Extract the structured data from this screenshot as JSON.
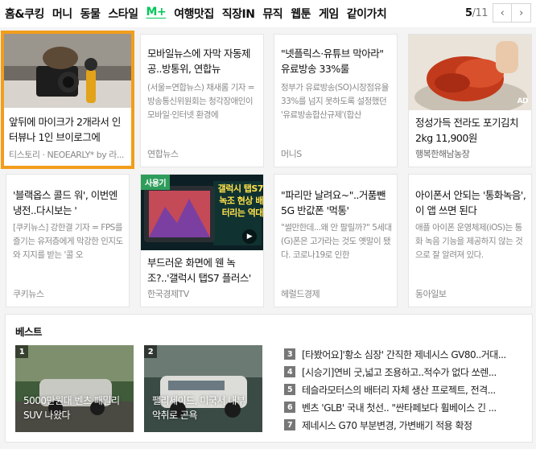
{
  "categories": [
    "홈&쿠킹",
    "머니",
    "동물",
    "스타일",
    "M+",
    "여행맛집",
    "직장IN",
    "뮤직",
    "웹툰",
    "게임",
    "같이가치"
  ],
  "active_category": "M+",
  "pager": {
    "current": "5",
    "total": "/11",
    "prev": "‹",
    "next": "›"
  },
  "cards": [
    {
      "title": "앞뒤에 마이크가 2개라서 인터뷰나 1인 브이로그에",
      "source": "티스토리 · NEOEARLY* by 라..."
    },
    {
      "title": "모바일뉴스에 자막 자동제공..방통위, 연합뉴",
      "desc": "(서울=연합뉴스) 채새롬 기자 = 방송통신위원회는 청각장애인이 모바일·인터넷 환경에",
      "source": "연합뉴스"
    },
    {
      "title": "\"넷플릭스·유튜브 막아라\" 유료방송 33%룰",
      "desc": "정부가 유료방송(SO)시장점유율 33%를 넘지 못하도록 설정했던 '유료방송합산규제'(합산",
      "source": "머니S"
    },
    {
      "title": "정성가득 전라도 포기김치 2kg 11,900원",
      "source": "행복한해남농장",
      "ad": "AD"
    },
    {
      "title": "'블랙옵스 콜드 워', 이번엔 냉전..다시보는 '",
      "desc": "[쿠키뉴스] 강한결 기자 = FPS를 즐기는 유저층에게 막강한 인지도와 지지를 받는 '콜 오",
      "source": "쿠키뉴스"
    },
    {
      "title": "부드러운 화면에 웬 녹조?..'갤럭시 탭S7 플러스'",
      "source": "한국경제TV",
      "badge": "사용기",
      "overlay": "갤럭시 탭S7 녹조 현상 배터리는 역대",
      "play": "▶"
    },
    {
      "title": "\"파리만 날려요~\"..거품뺀 5G 반값폰 '먹통'",
      "desc": "\"썰만한데...왜 안 팔릴까?\" 5세대(G)폰은 고가라는 것도 옛말이 됐다. 코로나19로 인한",
      "source": "헤럴드경제"
    },
    {
      "title": "아이폰서 안되는 '통화녹음', 이 앱 쓰면 된다",
      "desc": "애플 아이폰 운영체제(iOS)는 통화 녹음 기능을 제공하지 않는 것으로 잘 알려져 있다.",
      "source": "동아일보"
    }
  ],
  "best": {
    "title": "베스트",
    "top": [
      {
        "num": "1",
        "caption": "5000만원대 벤츠 패밀리 SUV 나왔다"
      },
      {
        "num": "2",
        "caption": "팰리세이드, 미국서 내부 악취로 곤욕"
      }
    ],
    "list": [
      {
        "num": "3",
        "text": "[타봤어요]'황소 심장' 간직한 제네시스 GV80..거대..."
      },
      {
        "num": "4",
        "text": "[시승기]연비 굿,넓고 조용하고..적수가 없다 쏘렌..."
      },
      {
        "num": "5",
        "text": "테슬라모터스의 배터리 자체 생산 프로젝트, 전격..."
      },
      {
        "num": "6",
        "text": "벤츠 'GLB' 국내 첫선.. \"싼타페보다 휠베이스 긴 ..."
      },
      {
        "num": "7",
        "text": "제네시스 G70 부분변경, 가변배기 적용 확정"
      }
    ]
  },
  "colors": {
    "accent": "#03c75a",
    "selection": "#f29d1b",
    "badge": "#2e9d5b"
  }
}
